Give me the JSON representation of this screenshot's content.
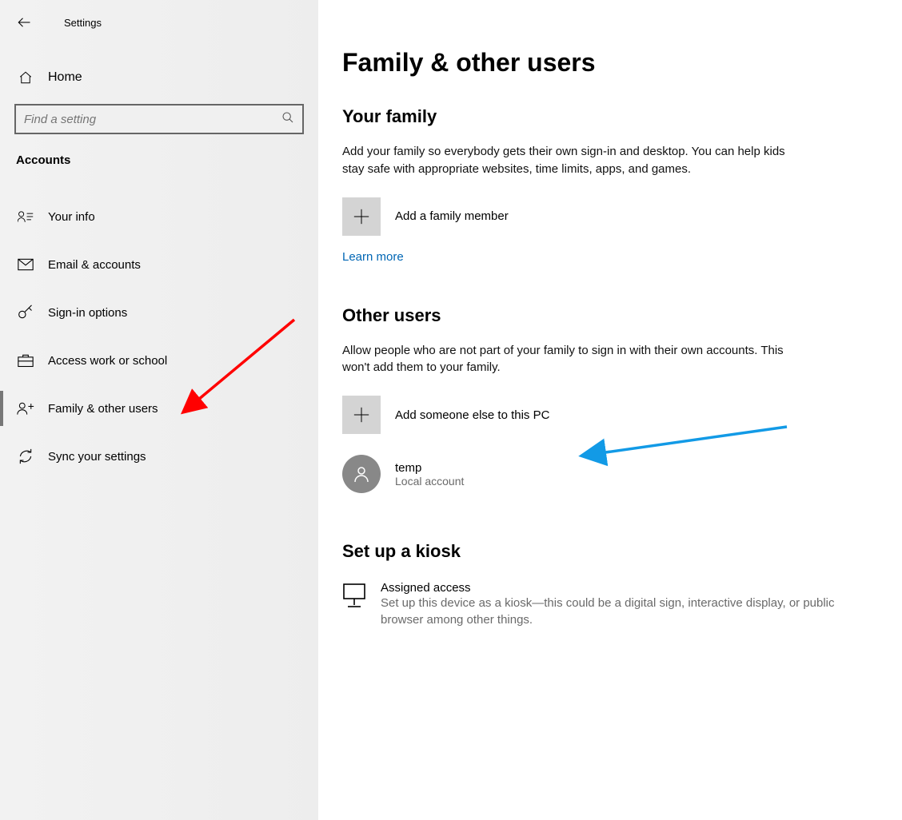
{
  "window": {
    "title": "Settings"
  },
  "sidebar": {
    "home": "Home",
    "search_placeholder": "Find a setting",
    "section": "Accounts",
    "items": [
      {
        "label": "Your info"
      },
      {
        "label": "Email & accounts"
      },
      {
        "label": "Sign-in options"
      },
      {
        "label": "Access work or school"
      },
      {
        "label": "Family & other users"
      },
      {
        "label": "Sync your settings"
      }
    ],
    "active_index": 4
  },
  "main": {
    "heading": "Family & other users",
    "family": {
      "title": "Your family",
      "desc": "Add your family so everybody gets their own sign-in and desktop. You can help kids stay safe with appropriate websites, time limits, apps, and games.",
      "add_label": "Add a family member",
      "learn_more": "Learn more"
    },
    "other": {
      "title": "Other users",
      "desc": "Allow people who are not part of your family to sign in with their own accounts. This won't add them to your family.",
      "add_label": "Add someone else to this PC",
      "users": [
        {
          "name": "temp",
          "type": "Local account"
        }
      ]
    },
    "kiosk": {
      "title": "Set up a kiosk",
      "item_title": "Assigned access",
      "item_desc": "Set up this device as a kiosk—this could be a digital sign, interactive display, or public browser among other things."
    }
  }
}
